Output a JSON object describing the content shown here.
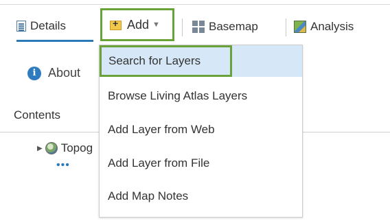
{
  "toolbar": {
    "details_label": "Details",
    "add_label": "Add",
    "basemap_label": "Basemap",
    "analysis_label": "Analysis",
    "accent_color": "#2a7ab8",
    "highlight_color": "#6aa23a"
  },
  "panel": {
    "about_label": "About",
    "contents_label": "Contents",
    "layer_label": "Topog"
  },
  "menu": {
    "items": [
      {
        "label": "Search for Layers"
      },
      {
        "label": "Browse Living Atlas Layers"
      },
      {
        "label": "Add Layer from Web"
      },
      {
        "label": "Add Layer from File"
      },
      {
        "label": "Add Map Notes"
      }
    ]
  },
  "icons": {
    "details": "details-icon",
    "add": "add-icon",
    "basemap": "basemap-icon",
    "analysis": "analysis-icon",
    "about": "info-icon",
    "layer": "globe-icon"
  }
}
